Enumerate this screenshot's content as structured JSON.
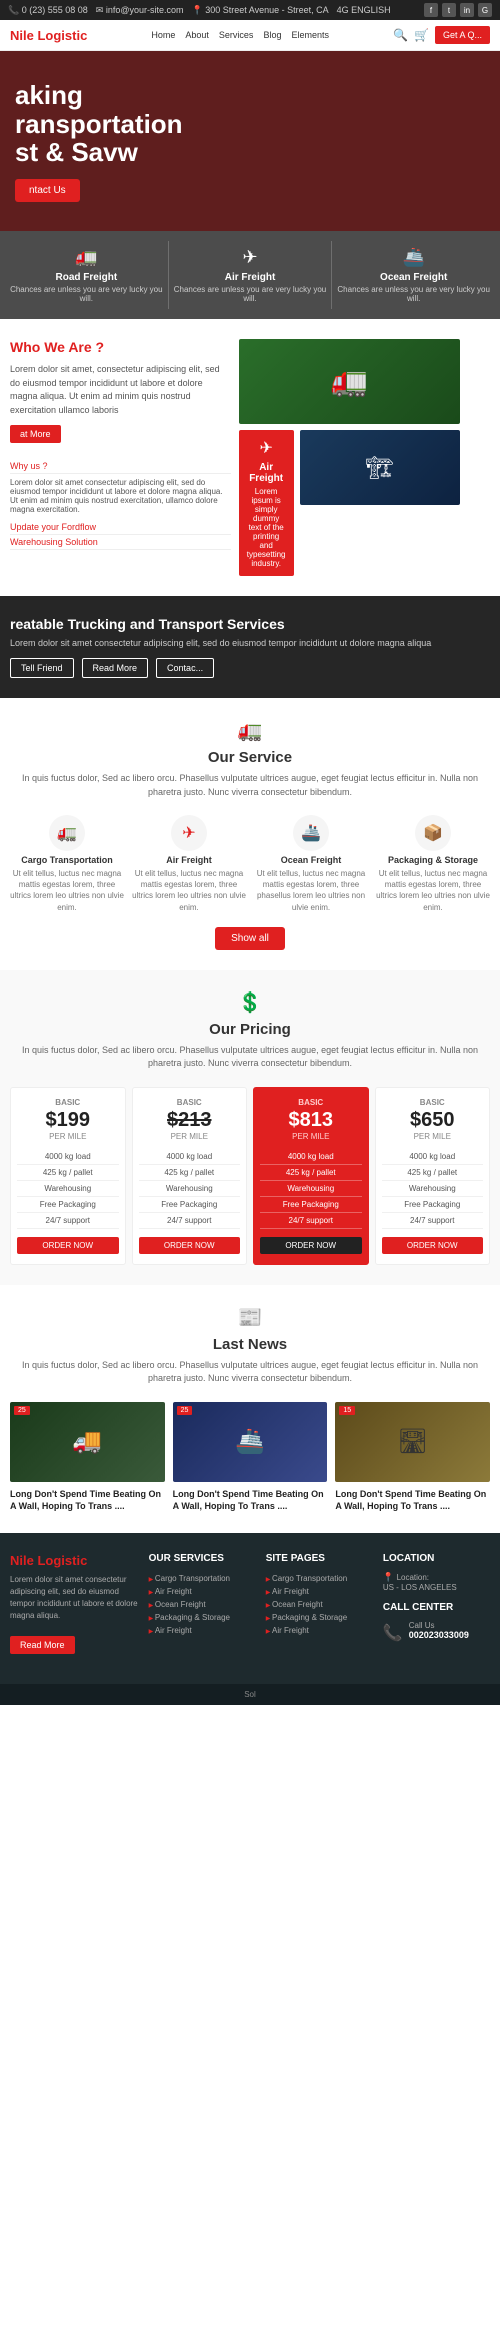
{
  "topbar": {
    "phone": "0 (23) 555 08 08",
    "email": "info@your-site.com",
    "address": "300 Street Avenue - Street, CA",
    "signal": "4G ENGLISH",
    "socials": [
      "f",
      "t",
      "in",
      "G+"
    ]
  },
  "nav": {
    "logo_prefix": "Nile ",
    "logo_highlight": "Logistic",
    "links": [
      "Home",
      "About",
      "Services",
      "Blog",
      "Elements"
    ],
    "cta": "Get A Q..."
  },
  "hero": {
    "line1": "aking",
    "line2": "ransportation",
    "line3": "st & Savw",
    "contact_btn": "ntact Us"
  },
  "service_cards": [
    {
      "icon": "🚛",
      "title": "Road Freight",
      "desc": "Chances are unless you are very lucky you will."
    },
    {
      "icon": "✈",
      "title": "Air Freight",
      "desc": "Chances are unless you are very lucky you will."
    },
    {
      "icon": "🚢",
      "title": "Ocean Freight",
      "desc": "Chances are unless you are very lucky you will."
    }
  ],
  "who": {
    "title": "Who We Are ?",
    "desc": "Lorem dolor sit amet, consectetur adipiscing elit, sed do eiusmod tempor incididunt ut labore et dolore magna aliqua. Ut enim ad minim quis nostrud exercitation ullamco laboris",
    "read_more": "at More",
    "nav_items": [
      "Why us ?",
      "Update your Fordflow",
      "Warehousing Solution"
    ],
    "nav_desc": "Lorem dolor sit amet consectetur adipiscing elit, sed do eiusmod tempor incididunt ut labore et dolore magna aliqua. Ut enim ad minim quis nostrud exercitation, ullamco dolore magna exercitation.",
    "air_freight": {
      "icon": "✈",
      "title": "Air Freight",
      "desc": "Lorem ipsum is simply dummy text of the printing and typesetting industry."
    }
  },
  "trucking": {
    "title": "reatable Trucking and Transport Services",
    "desc": "Lorem dolor sit amet consectetur adipiscing elit, sed do eiusmod tempor incididunt ut dolore magna aliqua",
    "buttons": [
      "Tell Friend",
      "Read More",
      "Contac..."
    ]
  },
  "our_service": {
    "icon": "🚛",
    "title": "Our Service",
    "desc": "In quis fuctus dolor, Sed ac libero orcu. Phasellus vulputate ultrices augue, eget feugiat lectus efficitur in. Nulla non pharetra justo. Nunc viverra consectetur bibendum.",
    "items": [
      {
        "icon": "🚛",
        "title": "Cargo Transportation",
        "desc": "Ut elit tellus, luctus nec magna mattis egestas lorem, three ultrics lorem leo ultries non ulvie enim."
      },
      {
        "icon": "✈",
        "title": "Air Freight",
        "desc": "Ut elit tellus, luctus nec magna mattis egestas lorem, three ultrics lorem leo ultries non ulvie enim."
      },
      {
        "icon": "🚢",
        "title": "Ocean Freight",
        "desc": "Ut elit tellus, luctus nec magna mattis egestas lorem, three phasellus lorem leo ultries non ulvie enim."
      },
      {
        "icon": "📦",
        "title": "Packaging & Storage",
        "desc": "Ut elit tellus, luctus nec magna mattis egestas lorem, three ultrics lorem leo ultries non ulvie enim."
      }
    ],
    "show_all": "Show all"
  },
  "pricing": {
    "icon": "💲",
    "title": "Our Pricing",
    "desc": "In quis fuctus dolor, Sed ac libero orcu. Phasellus vulputate ultrices augue, eget feugiat lectus efficitur in. Nulla non pharetra justo. Nunc viverra consectetur bibendum.",
    "plans": [
      {
        "label": "BASIC",
        "price": "$199",
        "unit": "PER MILE",
        "features": [
          "4000 kg load",
          "425 kg / pallet",
          "Warehousing",
          "Free Packaging",
          "24/7 support"
        ],
        "btn": "ORDER NOW",
        "featured": false
      },
      {
        "label": "BASIC",
        "price": "$213",
        "unit": "PER MILE",
        "features": [
          "4000 kg load",
          "425 kg / pallet",
          "Warehousing",
          "Free Packaging",
          "24/7 support"
        ],
        "btn": "ORDER NOW",
        "featured": false,
        "strikethrough": true
      },
      {
        "label": "BASIC",
        "price": "$813",
        "unit": "PER MILE",
        "features": [
          "4000 kg load",
          "425 kg / pallet",
          "Warehousing",
          "Free Packaging",
          "24/7 support"
        ],
        "btn": "ORDER NOW",
        "featured": true
      },
      {
        "label": "BASIC",
        "price": "$650",
        "unit": "PER MILE",
        "features": [
          "4000 kg load",
          "425 kg / pallet",
          "Warehousing",
          "Free Packaging",
          "24/7 support"
        ],
        "btn": "ORDER NOW",
        "featured": false
      }
    ]
  },
  "last_news": {
    "icon": "📰",
    "title": "Last News",
    "desc": "In quis fuctus dolor, Sed ac libero orcu. Phasellus vulputate ultrices augue, eget feugiat lectus efficitur in. Nulla non pharetra justo. Nunc viverra consectetur bibendum.",
    "items": [
      {
        "badge": "25",
        "img_type": "truck-img",
        "img_icon": "🚚",
        "title": "Long Don't Spend Time Beating On A Wall, Hoping To Trans ...."
      },
      {
        "badge": "25",
        "img_type": "ship-img",
        "img_icon": "🚢",
        "title": "Long Don't Spend Time Beating On A Wall, Hoping To Trans ...."
      },
      {
        "badge": "15",
        "img_type": "highway-img",
        "img_icon": "🛣",
        "title": "Long Don't Spend Time Beating On A Wall, Hoping To Trans ...."
      }
    ]
  },
  "footer": {
    "logo_prefix": "Nile ",
    "logo_highlight": "Logistic",
    "about": "Lorem dolor sit amet consectetur adipiscing elit, sed do eiusmod tempor incididunt ut labore et dolore magna aliqua.",
    "read_more": "Read More",
    "services": {
      "title": "OUR SERVICES",
      "items": [
        "Cargo Transportation",
        "Air Freight",
        "Ocean Freight",
        "Packaging & Storage",
        "Air Freight"
      ]
    },
    "site_pages": {
      "title": "SITE PAGES",
      "items": [
        "Cargo Transportation",
        "Air Freight",
        "Ocean Freight",
        "Packaging & Storage",
        "Air Freight"
      ]
    },
    "location": {
      "title": "LOCATION",
      "label": "Location:",
      "value": "US - LOS ANGELES"
    },
    "call_center": {
      "title": "CALL CENTER",
      "label": "Call Us",
      "number": "002023033009"
    }
  },
  "bottom_bar": {
    "text": "Sol"
  }
}
